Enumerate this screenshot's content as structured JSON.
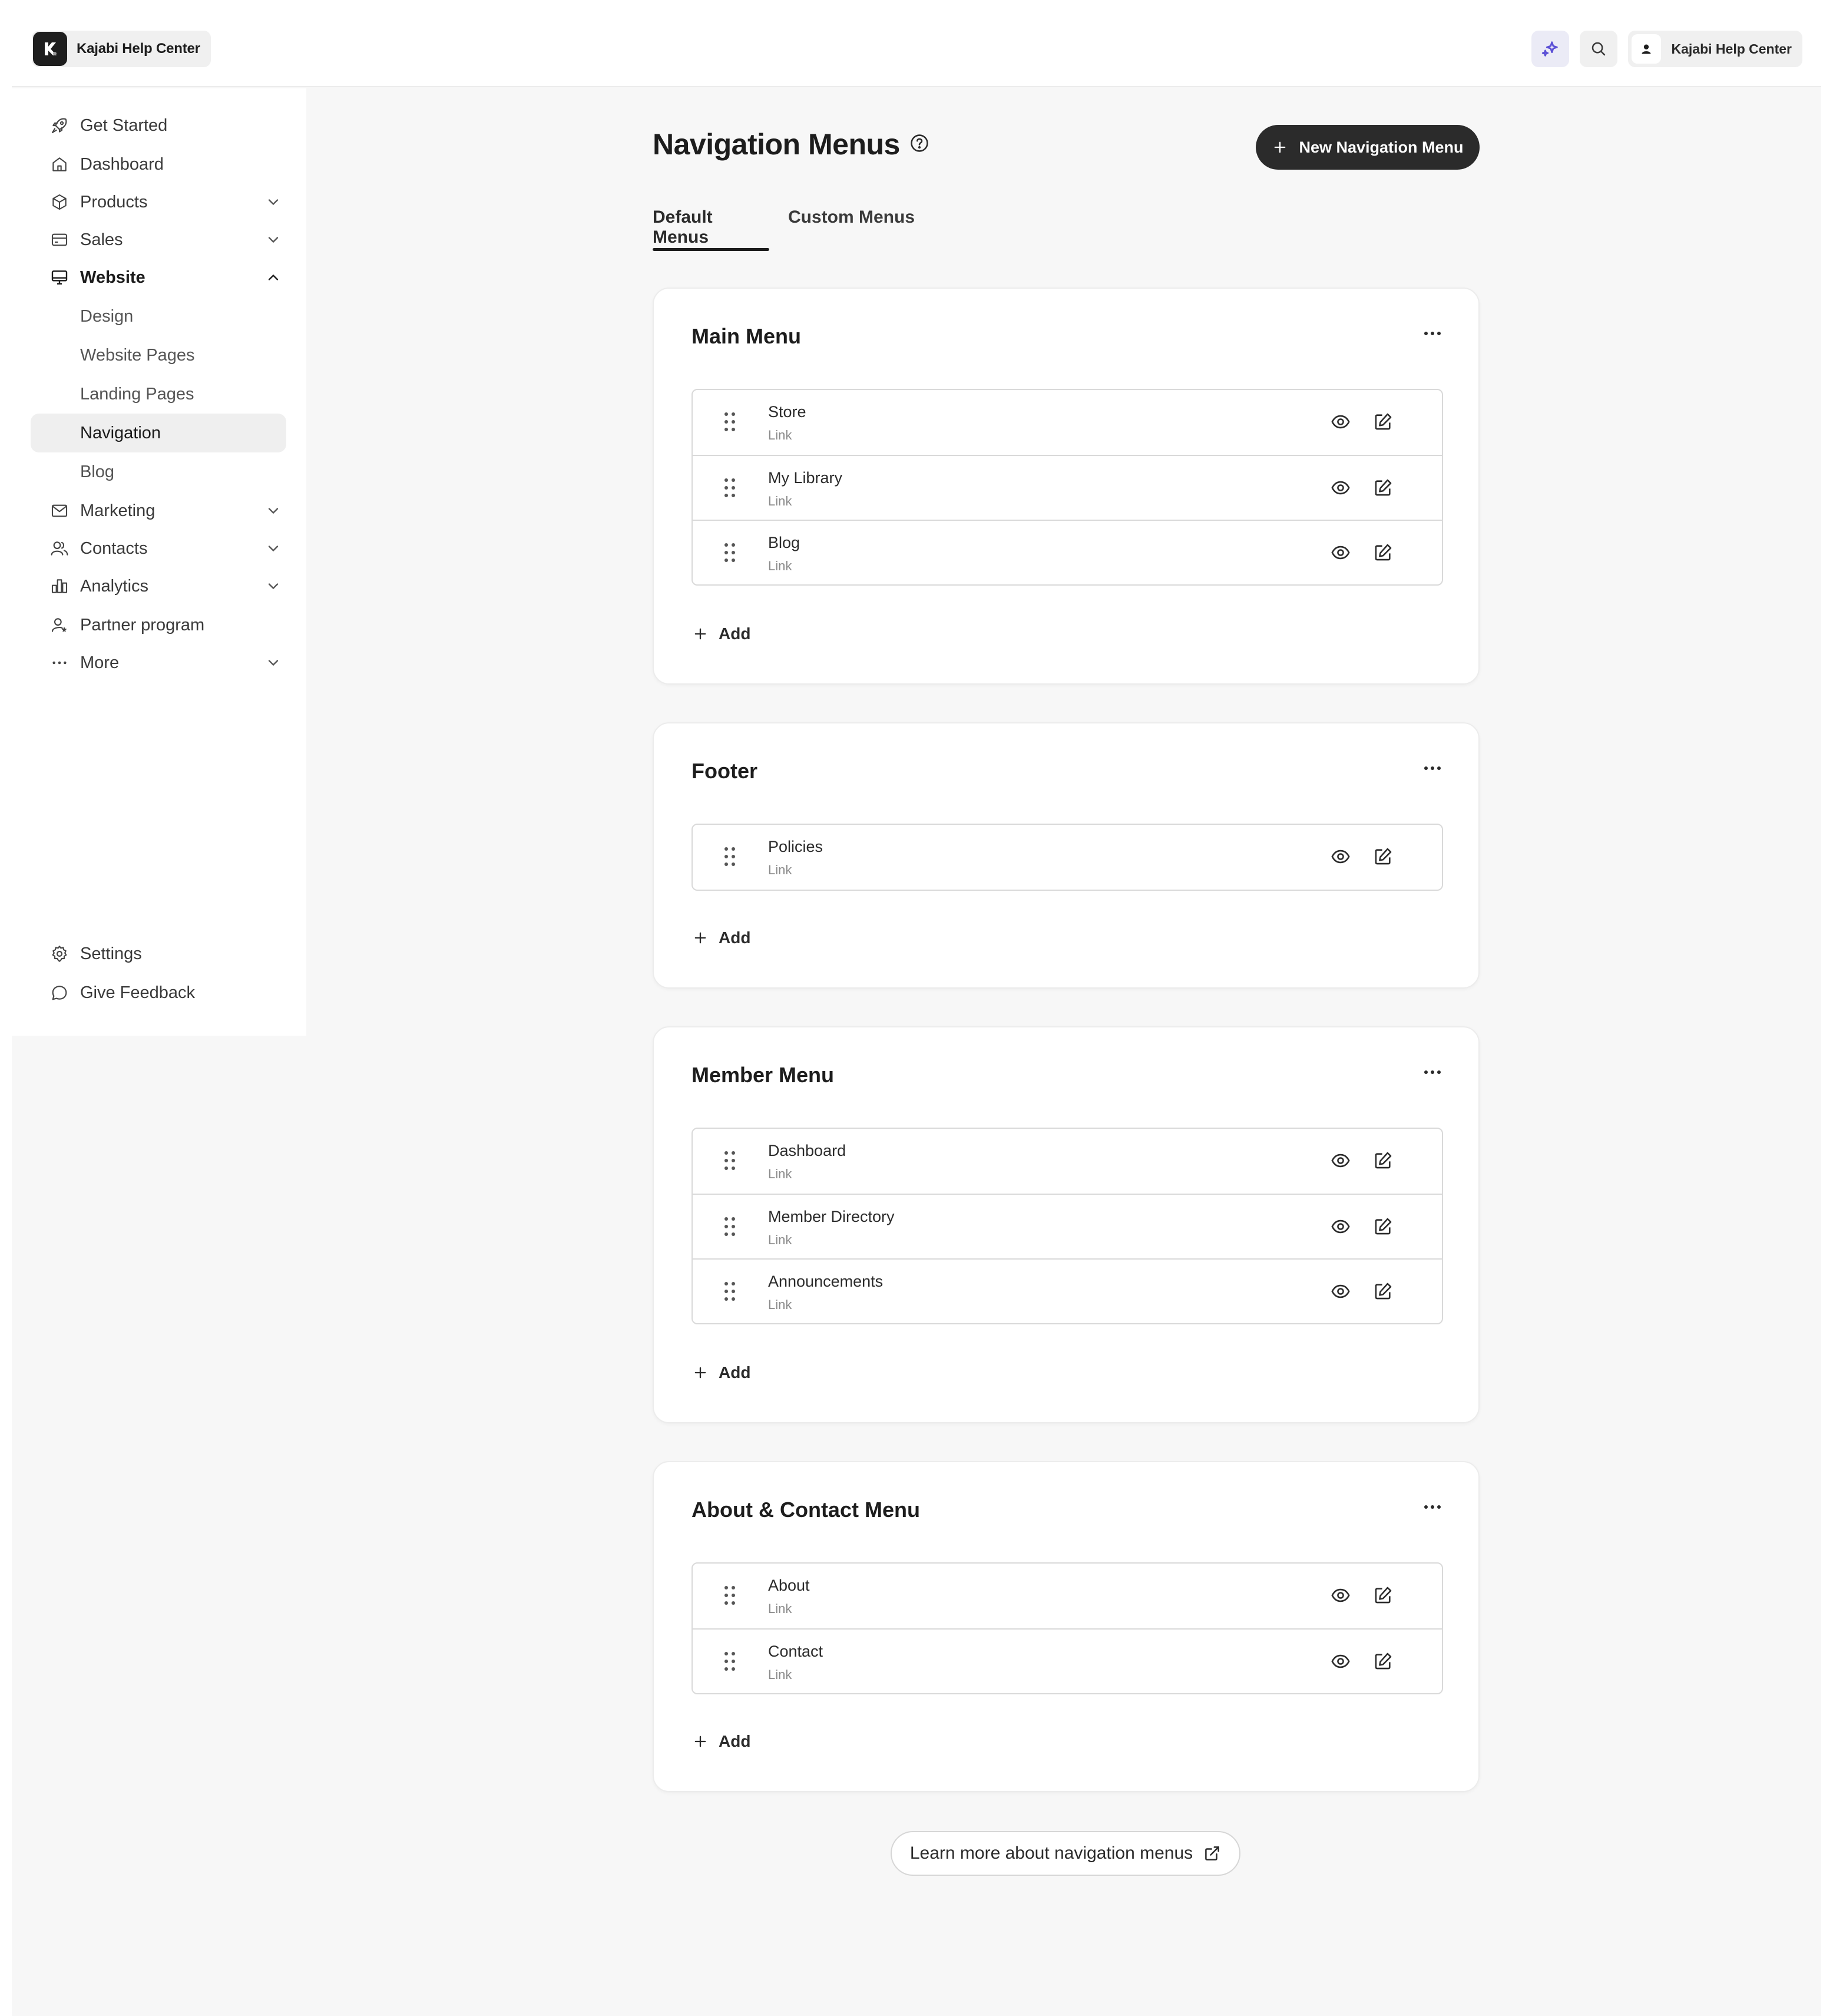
{
  "header": {
    "brand_name": "Kajabi Help Center",
    "account_name": "Kajabi Help Center",
    "icons": [
      "kajabi-logo-icon",
      "sparkle-icon",
      "search-icon",
      "user-icon"
    ],
    "accent_color": "#5b4fd6"
  },
  "sidebar": {
    "items": {
      "get_started": "Get Started",
      "dashboard": "Dashboard",
      "products": "Products",
      "sales": "Sales",
      "website": "Website",
      "design": "Design",
      "website_pages": "Website Pages",
      "landing_pages": "Landing Pages",
      "navigation": "Navigation",
      "blog": "Blog",
      "marketing": "Marketing",
      "contacts": "Contacts",
      "analytics": "Analytics",
      "partner_program": "Partner program",
      "more": "More"
    },
    "footer": {
      "settings": "Settings",
      "give_feedback": "Give Feedback"
    },
    "active_item": "Navigation"
  },
  "main": {
    "title": "Navigation Menus",
    "new_button": "New Navigation Menu",
    "tabs": [
      {
        "label": "Default Menus",
        "active": true
      },
      {
        "label": "Custom Menus",
        "active": false
      }
    ],
    "add_label": "Add",
    "menus": [
      {
        "title": "Main Menu",
        "items": [
          {
            "name": "Store",
            "type": "Link"
          },
          {
            "name": "My Library",
            "type": "Link"
          },
          {
            "name": "Blog",
            "type": "Link"
          }
        ]
      },
      {
        "title": "Footer",
        "items": [
          {
            "name": "Policies",
            "type": "Link"
          }
        ]
      },
      {
        "title": "Member Menu",
        "items": [
          {
            "name": "Dashboard",
            "type": "Link"
          },
          {
            "name": "Member Directory",
            "type": "Link"
          },
          {
            "name": "Announcements",
            "type": "Link"
          }
        ]
      },
      {
        "title": "About & Contact Menu",
        "items": [
          {
            "name": "About",
            "type": "Link"
          },
          {
            "name": "Contact",
            "type": "Link"
          }
        ]
      }
    ],
    "learn_more": "Learn more about navigation menus"
  }
}
